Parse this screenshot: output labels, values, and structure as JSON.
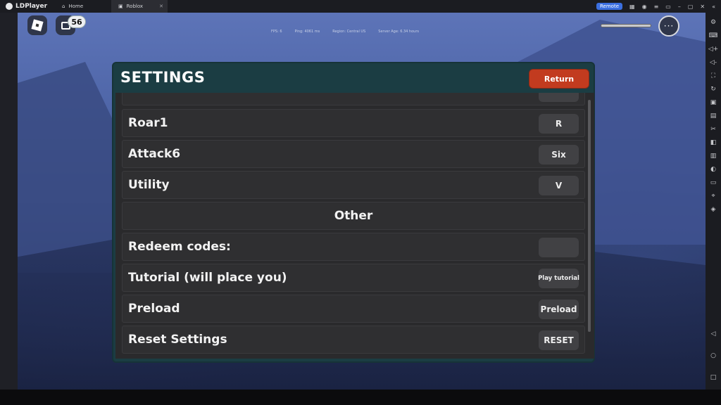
{
  "emulator": {
    "brand": "LDPlayer",
    "tabs": [
      {
        "label": "Home"
      },
      {
        "label": "Roblox"
      }
    ],
    "remote_label": "Remote"
  },
  "hud": {
    "chat_badge": "56",
    "stats": [
      "FPS: 6",
      "Ping: 4061 ms",
      "Region: Central US",
      "Server Age: 6.34 hours"
    ],
    "more_label": "···"
  },
  "settings": {
    "title": "SETTINGS",
    "return_label": "Return",
    "rows": [
      {
        "label": "Roar1",
        "button": "R"
      },
      {
        "label": "Attack6",
        "button": "Six"
      },
      {
        "label": "Utility",
        "button": "V"
      },
      {
        "label": "Other",
        "header": true
      },
      {
        "label": "Redeem codes:",
        "button": ""
      },
      {
        "label": "Tutorial (will place you)",
        "button": "Play tutorial"
      },
      {
        "label": "Preload",
        "button": "Preload"
      },
      {
        "label": "Reset Settings",
        "button": "RESET"
      }
    ]
  },
  "colors": {
    "panel": "#1b3d43",
    "return_button": "#c23b1f",
    "row_bg": "#2f2f31",
    "key_button": "#414144"
  },
  "icons": {
    "sidebar": [
      "gear-icon",
      "keyboard-icon",
      "volume-up-icon",
      "volume-down-icon",
      "fullscreen-icon",
      "rotate-icon",
      "apk-icon",
      "record-icon",
      "scissors-icon",
      "multi-instance-icon",
      "sync-icon",
      "operation-icon",
      "folder-icon",
      "location-icon",
      "shake-icon"
    ],
    "nav": [
      "back-icon",
      "home-icon",
      "recent-apps-icon"
    ]
  }
}
